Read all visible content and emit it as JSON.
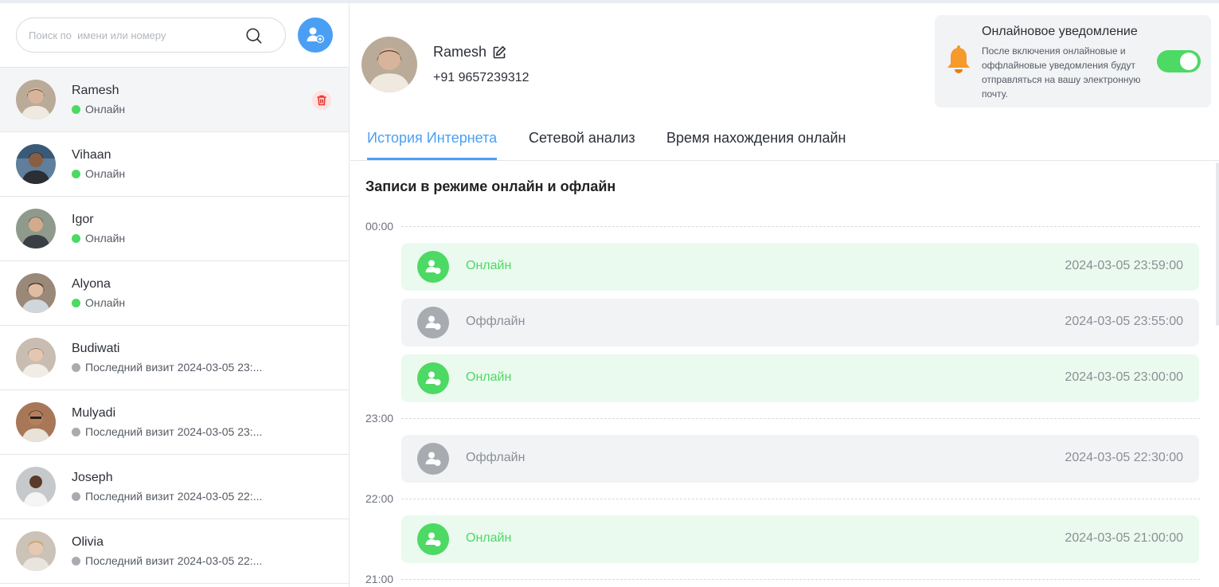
{
  "search": {
    "placeholder": "Поиск по  имени или номеру"
  },
  "contacts": [
    {
      "name": "Ramesh",
      "status": "Онлайн",
      "online": true
    },
    {
      "name": "Vihaan",
      "status": "Онлайн",
      "online": true
    },
    {
      "name": "Igor",
      "status": "Онлайн",
      "online": true
    },
    {
      "name": "Alyona",
      "status": "Онлайн",
      "online": true
    },
    {
      "name": "Budiwati",
      "status": "Последний визит 2024-03-05 23:...",
      "online": false
    },
    {
      "name": "Mulyadi",
      "status": "Последний визит 2024-03-05 23:...",
      "online": false
    },
    {
      "name": "Joseph",
      "status": "Последний визит 2024-03-05 22:...",
      "online": false
    },
    {
      "name": "Olivia",
      "status": "Последний визит 2024-03-05 22:...",
      "online": false
    }
  ],
  "profile": {
    "name": "Ramesh",
    "phone": "+91 9657239312"
  },
  "notification": {
    "title": "Онлайновое уведомление",
    "description": "После включения онлайновые и оффлайновые уведомления будут отправляться на вашу электронную почту.",
    "enabled": true
  },
  "tabs": [
    "История Интернета",
    "Сетевой анализ",
    "Время нахождения онлайн"
  ],
  "active_tab": "История Интернета",
  "section_title": "Записи в режиме онлайн и офлайн",
  "timeline": {
    "hours": [
      "00:00",
      "23:00",
      "22:00",
      "21:00"
    ],
    "records": [
      {
        "status": "Онлайн",
        "time": "2024-03-05 23:59:00"
      },
      {
        "status": "Оффлайн",
        "time": "2024-03-05 23:55:00"
      },
      {
        "status": "Онлайн",
        "time": "2024-03-05 23:00:00"
      },
      {
        "status": "Оффлайн",
        "time": "2024-03-05 22:30:00"
      },
      {
        "status": "Онлайн",
        "time": "2024-03-05 21:00:00"
      }
    ]
  },
  "colors": {
    "accent": "#4a9ff5",
    "online": "#4cd964",
    "offline": "#a8abb0",
    "danger": "#e53935",
    "bell": "#f59a2b"
  }
}
